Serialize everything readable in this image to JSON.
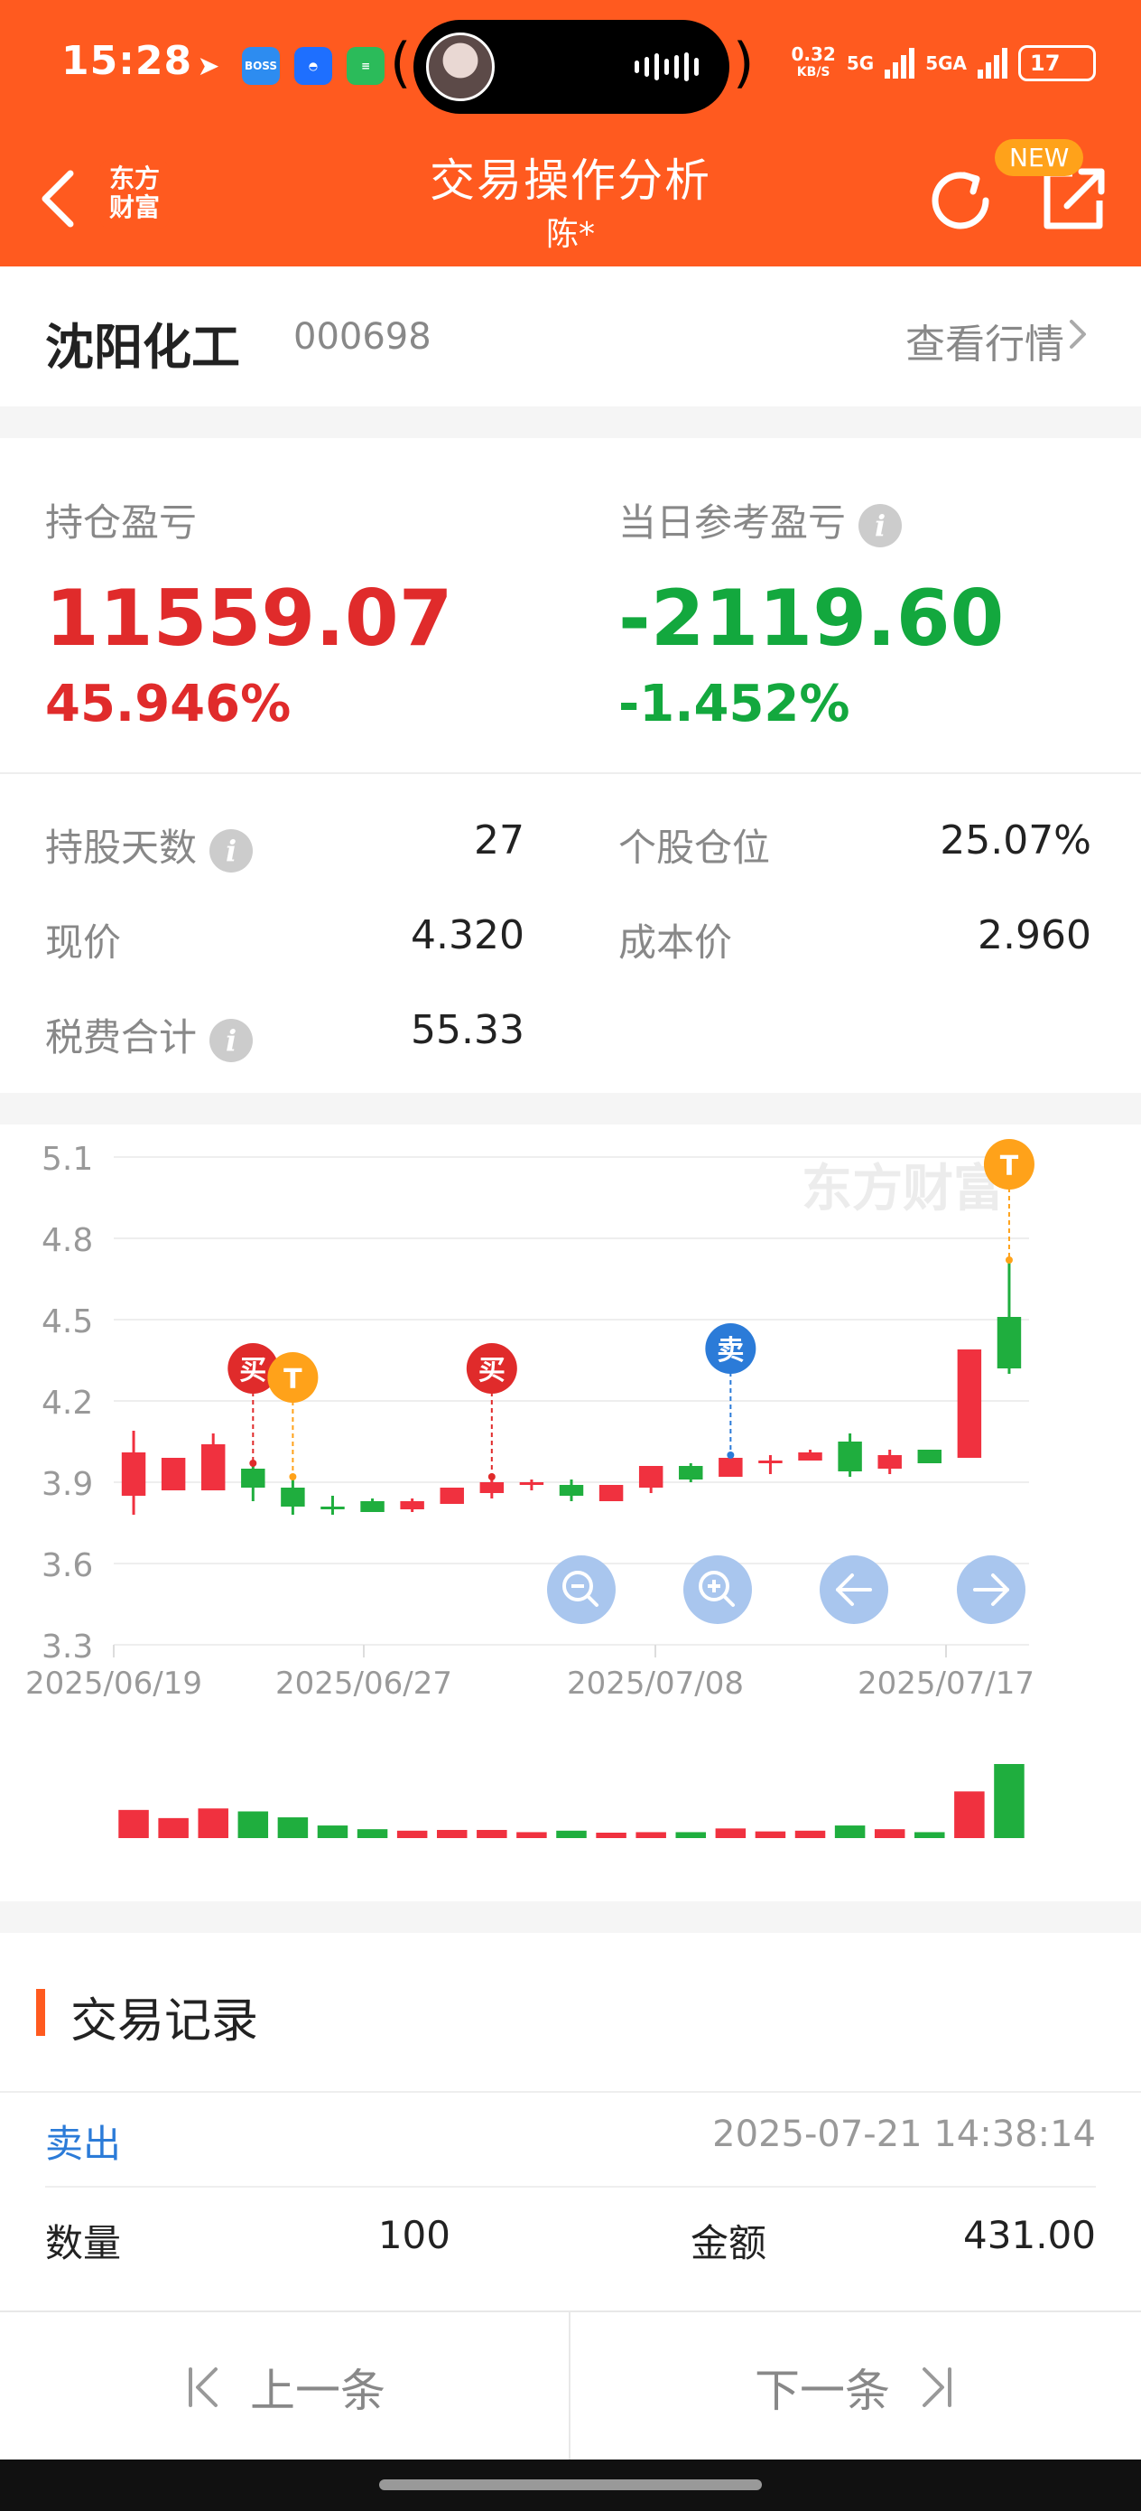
{
  "status_bar": {
    "time": "15:28",
    "net_speed": "0.32",
    "net_unit": "KB/S",
    "sim1": "5G",
    "sim2": "5GA",
    "battery": "17"
  },
  "nav": {
    "logo_text": "东方财富",
    "title": "交易操作分析",
    "subtitle": "陈*",
    "new_badge": "NEW"
  },
  "stock": {
    "name": "沈阳化工",
    "code": "000698",
    "view_quote": "查看行情"
  },
  "pnl": {
    "position_label": "持仓盈亏",
    "position_value": "11559.07",
    "position_pct": "45.946%",
    "daily_label": "当日参考盈亏",
    "daily_value": "-2119.60",
    "daily_pct": "-1.452%",
    "stats": [
      {
        "label": "持股天数",
        "value": "27",
        "info": true
      },
      {
        "label": "个股仓位",
        "value": "25.07%",
        "info": false
      },
      {
        "label": "现价",
        "value": "4.320",
        "info": false
      },
      {
        "label": "成本价",
        "value": "2.960",
        "info": false
      },
      {
        "label": "税费合计",
        "value": "55.33",
        "info": true
      }
    ],
    "colors": {
      "gain": "#e02b2b",
      "loss": "#13a83e"
    }
  },
  "chart_data": {
    "type": "candlestick",
    "y_ticks": [
      "5.1",
      "4.8",
      "4.5",
      "4.2",
      "3.9",
      "3.6",
      "3.3"
    ],
    "ylim": [
      3.3,
      5.1
    ],
    "x_ticks": [
      "2025/06/19",
      "2025/06/27",
      "2025/07/08",
      "2025/07/17"
    ],
    "watermark": "东方财富",
    "candles": [
      {
        "o": 3.85,
        "c": 4.01,
        "h": 4.09,
        "l": 3.78
      },
      {
        "o": 3.87,
        "c": 3.99,
        "h": 3.99,
        "l": 3.87
      },
      {
        "o": 3.87,
        "c": 4.04,
        "h": 4.08,
        "l": 3.87
      },
      {
        "o": 3.95,
        "c": 3.88,
        "h": 3.97,
        "l": 3.83
      },
      {
        "o": 3.88,
        "c": 3.81,
        "h": 3.92,
        "l": 3.78
      },
      {
        "o": 3.81,
        "c": 3.8,
        "h": 3.85,
        "l": 3.78
      },
      {
        "o": 3.83,
        "c": 3.79,
        "h": 3.84,
        "l": 3.79
      },
      {
        "o": 3.8,
        "c": 3.83,
        "h": 3.84,
        "l": 3.79
      },
      {
        "o": 3.82,
        "c": 3.88,
        "h": 3.88,
        "l": 3.82
      },
      {
        "o": 3.86,
        "c": 3.9,
        "h": 3.92,
        "l": 3.84
      },
      {
        "o": 3.9,
        "c": 3.9,
        "h": 3.91,
        "l": 3.87
      },
      {
        "o": 3.89,
        "c": 3.85,
        "h": 3.91,
        "l": 3.83
      },
      {
        "o": 3.83,
        "c": 3.89,
        "h": 3.89,
        "l": 3.83
      },
      {
        "o": 3.88,
        "c": 3.96,
        "h": 3.96,
        "l": 3.86
      },
      {
        "o": 3.96,
        "c": 3.91,
        "h": 3.97,
        "l": 3.9
      },
      {
        "o": 3.92,
        "c": 3.99,
        "h": 4.0,
        "l": 3.92
      },
      {
        "o": 3.98,
        "c": 3.98,
        "h": 4.0,
        "l": 3.93
      },
      {
        "o": 3.98,
        "c": 4.01,
        "h": 4.02,
        "l": 3.98
      },
      {
        "o": 4.05,
        "c": 3.94,
        "h": 4.08,
        "l": 3.92
      },
      {
        "o": 3.95,
        "c": 4.0,
        "h": 4.02,
        "l": 3.93
      },
      {
        "o": 4.02,
        "c": 3.97,
        "h": 4.02,
        "l": 3.97
      },
      {
        "o": 3.99,
        "c": 4.39,
        "h": 4.39,
        "l": 3.99
      },
      {
        "o": 4.51,
        "c": 4.32,
        "h": 4.72,
        "l": 4.3
      }
    ],
    "volume": [
      0.38,
      0.27,
      0.4,
      0.36,
      0.28,
      0.17,
      0.12,
      0.1,
      0.11,
      0.11,
      0.08,
      0.1,
      0.07,
      0.08,
      0.08,
      0.13,
      0.09,
      0.1,
      0.17,
      0.12,
      0.08,
      0.63,
      1.0
    ],
    "markers": [
      {
        "index": 3,
        "label": "买",
        "color": "#e02b2b"
      },
      {
        "index": 4,
        "label": "T",
        "color": "#ffa21a"
      },
      {
        "index": 9,
        "label": "买",
        "color": "#e02b2b"
      },
      {
        "index": 15,
        "label": "卖",
        "color": "#2b7bd8"
      },
      {
        "index": 22,
        "label": "T",
        "color": "#ffa21a"
      }
    ],
    "controls": [
      "zoom-out",
      "zoom-in",
      "left",
      "right"
    ]
  },
  "records": {
    "title": "交易记录",
    "type": "卖出",
    "datetime": "2025-07-21 14:38:14",
    "qty_label": "数量",
    "qty_value": "100",
    "amount_label": "金额",
    "amount_value": "431.00"
  },
  "bottom": {
    "prev": "上一条",
    "next": "下一条"
  }
}
